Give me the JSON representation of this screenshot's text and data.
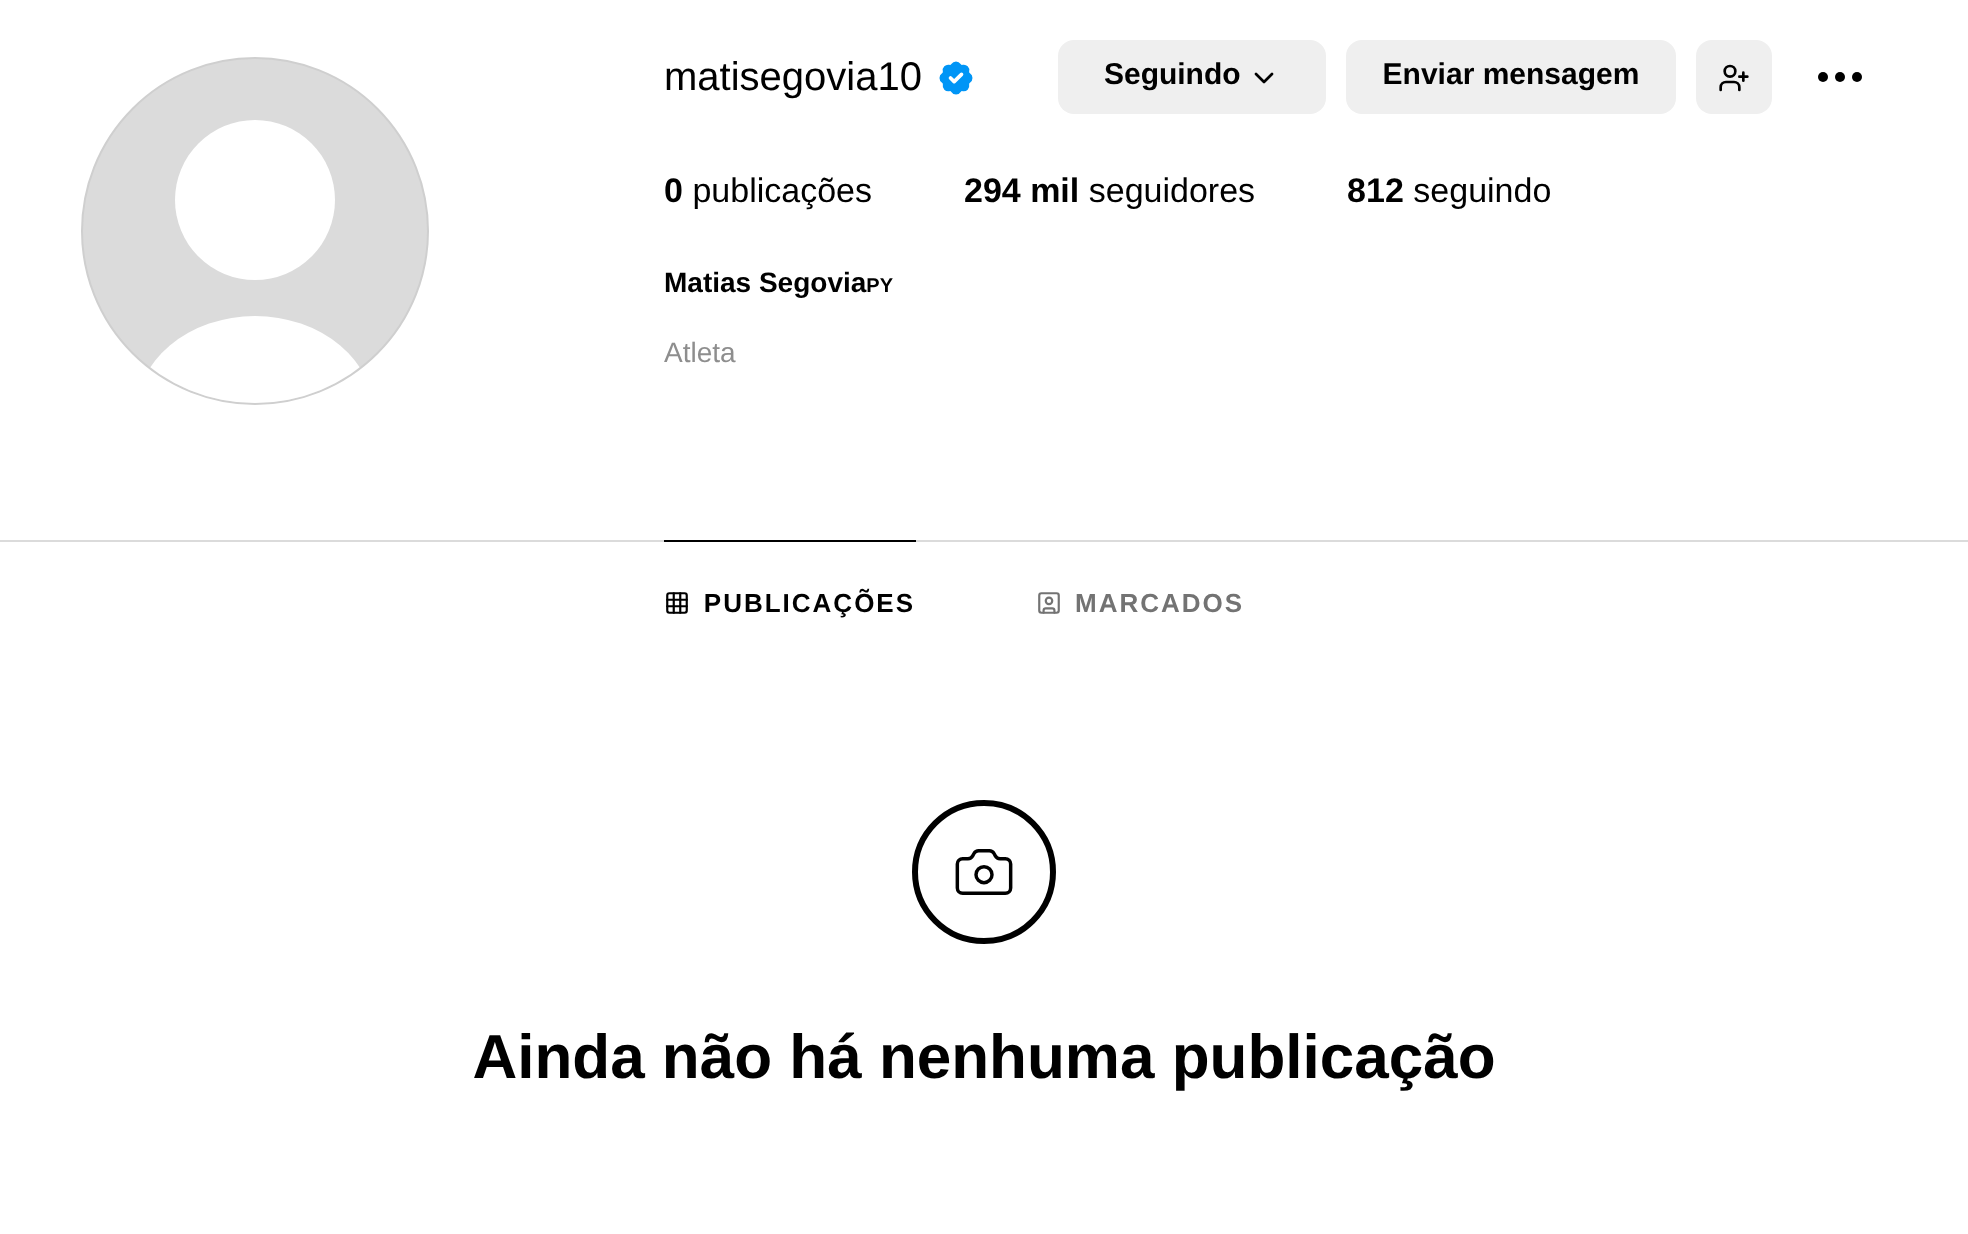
{
  "profile": {
    "username": "matisegovia10",
    "verified": true,
    "name": "Matias Segovia",
    "name_suffix": "PY",
    "category": "Atleta"
  },
  "buttons": [
    {
      "kind": "dropdown",
      "label": "Seguindo"
    },
    {
      "kind": "text",
      "label": "Enviar mensagem"
    },
    {
      "kind": "add-person"
    }
  ],
  "stats": [
    {
      "count": "0",
      "label": "publicações"
    },
    {
      "count": "294 mil",
      "label": "seguidores"
    },
    {
      "count": "812",
      "label": "seguindo"
    }
  ],
  "tabs": [
    {
      "kind": "grid",
      "label": "PUBLICAÇÕES",
      "selected": true
    },
    {
      "kind": "tagged",
      "label": "MARCADOS",
      "selected": false
    }
  ],
  "empty_state": {
    "title": "Ainda não há nenhuma publicação"
  }
}
